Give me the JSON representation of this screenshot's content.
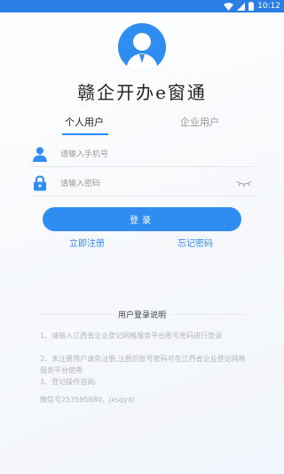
{
  "status_bar": {
    "time": "10:12"
  },
  "app": {
    "title": "赣企开办e窗通"
  },
  "tabs": [
    {
      "label": "个人用户",
      "active": true
    },
    {
      "label": "企业用户",
      "active": false
    }
  ],
  "form": {
    "phone_placeholder": "请输入手机号",
    "password_placeholder": "请输入密码",
    "login_label": "登录"
  },
  "links": {
    "register": "立即注册",
    "forgot": "忘记密码"
  },
  "notice": {
    "title": "用户登录说明",
    "items": [
      "1、请输入江西省企业登记网格服务平台账号密码进行登录",
      "2、未注册用户请先注册,注册后账号密码可在江西省企业登记网格服务平台使用",
      "3、登记操作咨询:",
      "微信号253595680，jxsqyd)"
    ]
  },
  "colors": {
    "accent": "#2f8cf0",
    "status_bar": "#2a7ee6"
  },
  "icons": [
    "wifi-icon",
    "signal-icon",
    "battery-icon",
    "avatar-icon",
    "user-icon",
    "lock-icon",
    "eye-closed-icon"
  ]
}
